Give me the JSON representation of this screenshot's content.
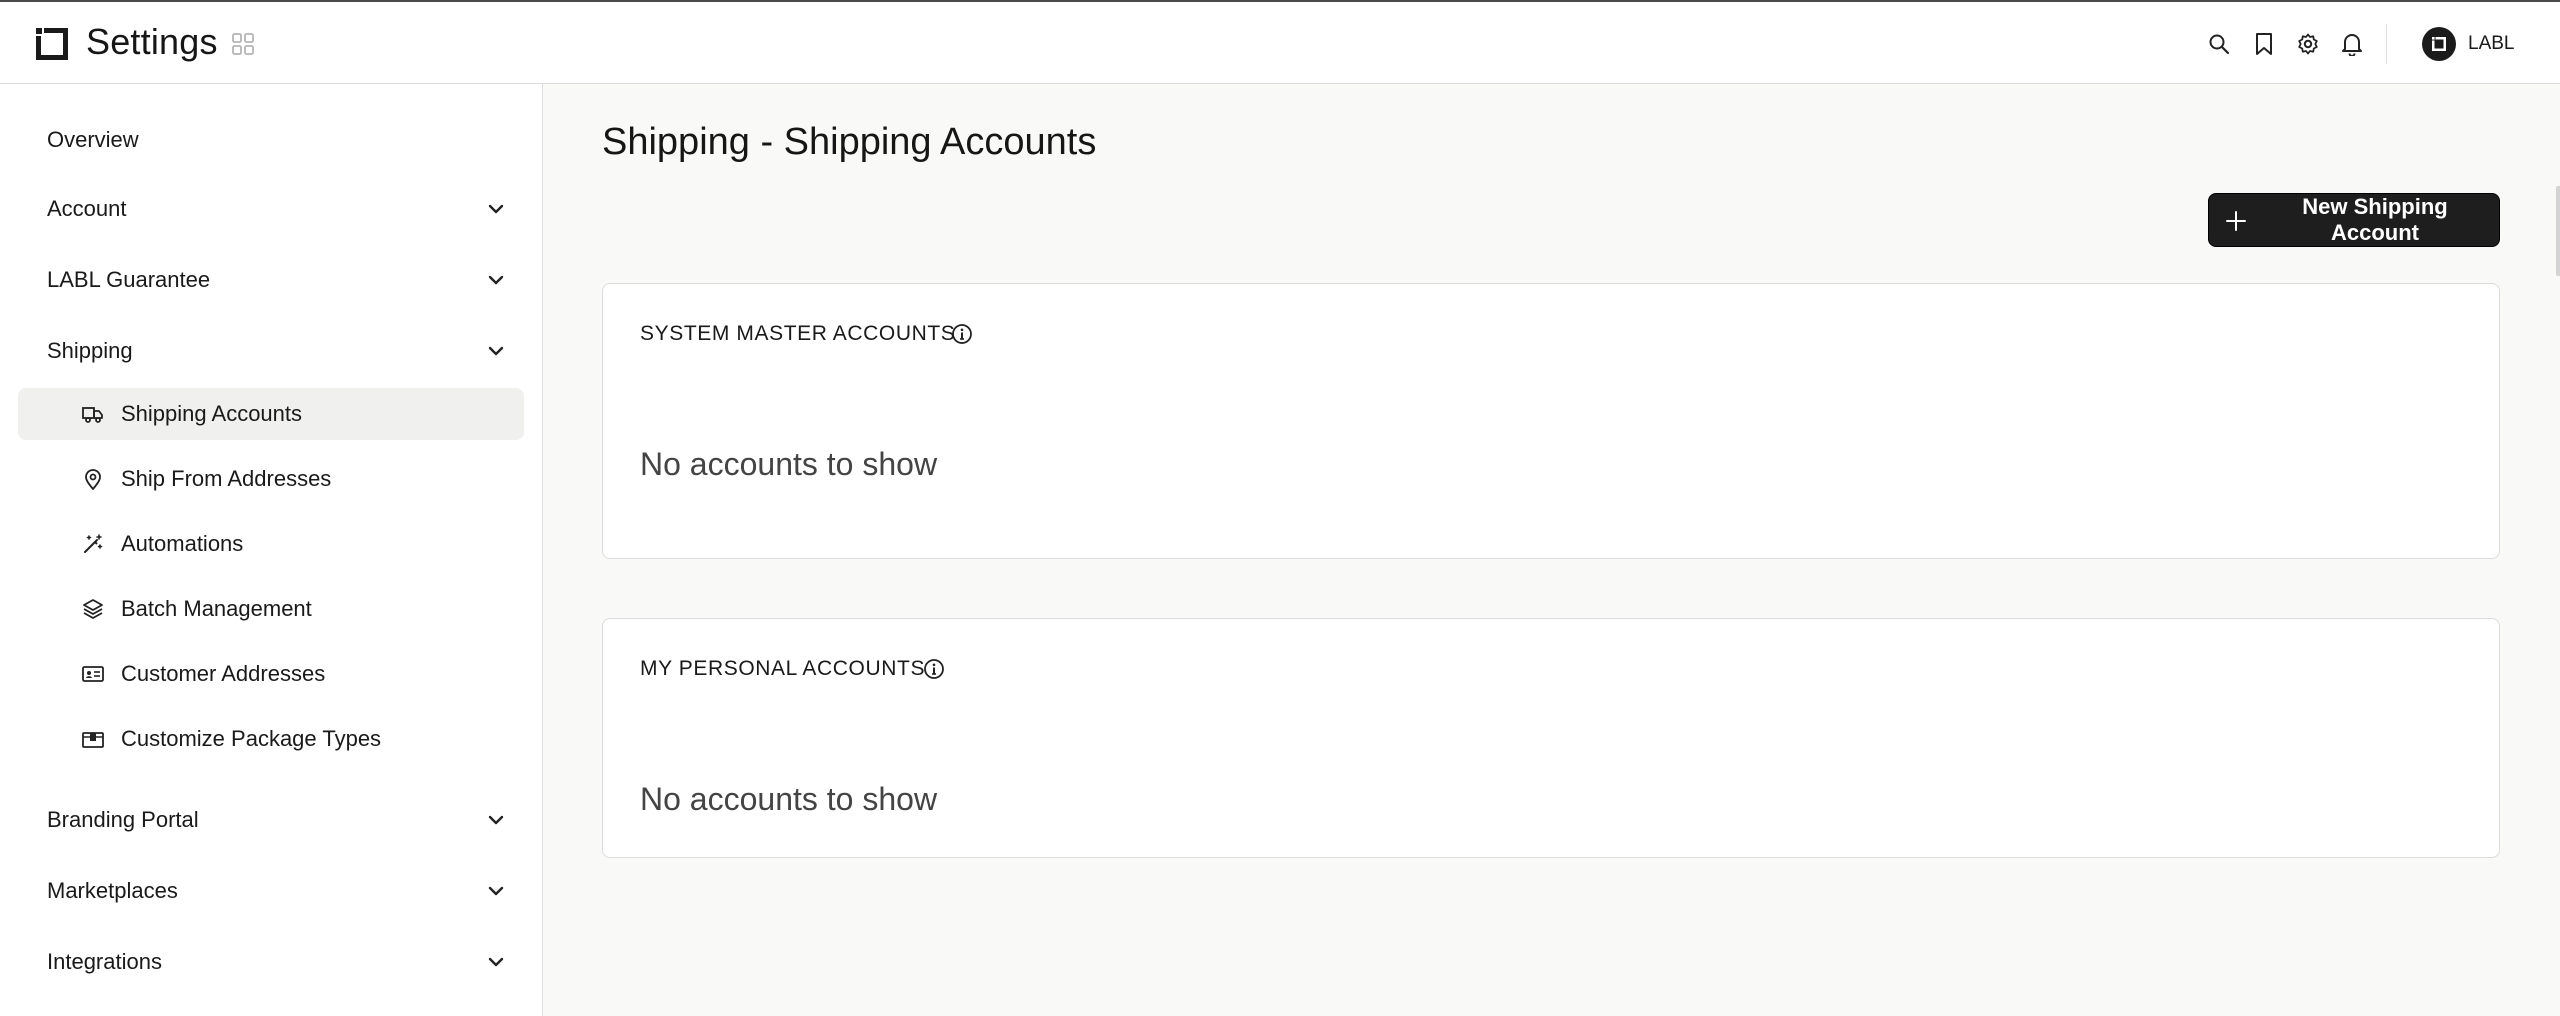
{
  "header": {
    "title": "Settings",
    "user_name": "LABL",
    "icons": [
      "grid-icon",
      "search-icon",
      "bookmark-icon",
      "gear-icon",
      "bell-icon"
    ]
  },
  "sidebar": {
    "overview": "Overview",
    "account": "Account",
    "guarantee": "LABL Guarantee",
    "shipping": "Shipping",
    "shipping_items": [
      {
        "label": "Shipping Accounts",
        "icon": "truck-icon",
        "active": true
      },
      {
        "label": "Ship From Addresses",
        "icon": "map-pin-icon",
        "active": false
      },
      {
        "label": "Automations",
        "icon": "magic-wand-icon",
        "active": false
      },
      {
        "label": "Batch Management",
        "icon": "layers-icon",
        "active": false
      },
      {
        "label": "Customer Addresses",
        "icon": "address-card-icon",
        "active": false
      },
      {
        "label": "Customize Package Types",
        "icon": "package-icon",
        "active": false
      }
    ],
    "branding": "Branding Portal",
    "marketplaces": "Marketplaces",
    "integrations": "Integrations"
  },
  "main": {
    "page_title": "Shipping - Shipping Accounts",
    "new_button_label": "New Shipping Account",
    "cards": [
      {
        "title": "SYSTEM MASTER ACCOUNTS",
        "empty_text": "No accounts to show"
      },
      {
        "title": "MY PERSONAL ACCOUNTS",
        "empty_text": "No accounts to show"
      }
    ]
  },
  "colors": {
    "primary_button": "#1e1e1e",
    "page_background": "#f9f9f8",
    "active_nav_background": "#f0f0ef",
    "border": "#dcdcdc"
  }
}
